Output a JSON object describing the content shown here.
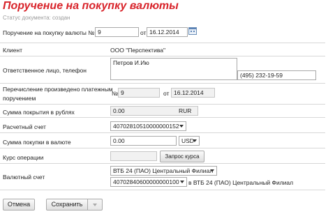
{
  "title": "Поручение на покупку валюты",
  "status": "Статус документа: создан",
  "header_row": {
    "label": "Поручение на покупку валюты №",
    "number": "9",
    "from_label": "от",
    "date": "16.12.2014"
  },
  "client": {
    "label": "Клиент",
    "value": "ООО \"Перспектива\""
  },
  "responsible": {
    "label": "Ответственное лицо, телефон",
    "name": "Петров И.Ию",
    "phone": "(495) 232-19-59"
  },
  "transfer": {
    "label_line1": "Перечисление произведено платежным",
    "label_line2": "поручением",
    "number_label": "№",
    "number": "9",
    "from_label": "от",
    "date": "16.12.2014"
  },
  "coverage": {
    "label": "Сумма покрытия в рублях",
    "value": "0.00",
    "currency": "RUR"
  },
  "account": {
    "label": "Расчетный счет",
    "value": "40702810510000000152"
  },
  "purchase": {
    "label": "Сумма покупки в валюте",
    "value": "0.00",
    "currency": "USD"
  },
  "rate": {
    "label": "Курс операции",
    "button": "Запрос курса"
  },
  "fx_account": {
    "label": "Валютный счет",
    "bank": "ВТБ 24 (ПАО) Центральный Филиал",
    "account": "40702840600000000100",
    "in_label": "в ВТБ 24 (ПАО) Центральный Филиал"
  },
  "footer": {
    "cancel": "Отмена",
    "save": "Сохранить"
  }
}
